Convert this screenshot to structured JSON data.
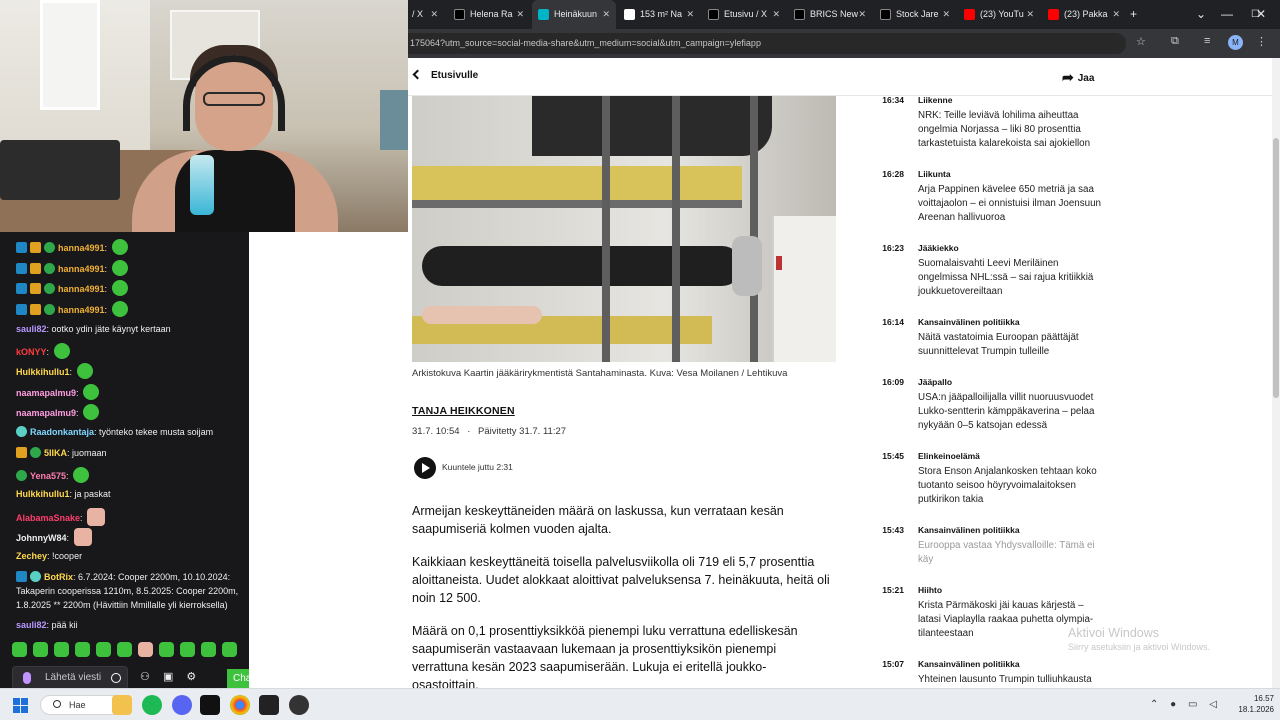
{
  "chat": {
    "messages": [
      {
        "user": "hanna4991",
        "color": "#f0b033",
        "text": ""
      },
      {
        "user": "hanna4991",
        "color": "#f0b033",
        "text": ""
      },
      {
        "user": "hanna4991",
        "color": "#f0b033",
        "text": ""
      },
      {
        "user": "hanna4991",
        "color": "#f0b033",
        "text": ""
      },
      {
        "user": "sauli82",
        "color": "#b897ff",
        "text": "ootko ydin jäte käynyt kertaan"
      },
      {
        "user": "kONYY",
        "color": "#ff3d3d",
        "text": ""
      },
      {
        "user": "Hulkkihullu1",
        "color": "#ffd84d",
        "text": ""
      },
      {
        "user": "naamapalmu9",
        "color": "#ff9de0",
        "text": ""
      },
      {
        "user": "naamapalmu9",
        "color": "#ff9de0",
        "text": ""
      },
      {
        "user": "Raadonkantaja",
        "color": "#7fd7ff",
        "text": "työnteko tekee musta soijam"
      },
      {
        "user": "5IIKA",
        "color": "#ffd84d",
        "text": "juomaan"
      },
      {
        "user": "Yena575",
        "color": "#ff7eb0",
        "text": ""
      },
      {
        "user": "Hulkkihullu1",
        "color": "#ffd84d",
        "text": "ja paskat"
      },
      {
        "user": "AlabamaSnake",
        "color": "#ff3d6a",
        "text": ""
      },
      {
        "user": "JohnnyW84",
        "color": "#efeff1",
        "text": ""
      },
      {
        "user": "Zechey",
        "color": "#ffd84d",
        "text": "!cooper"
      },
      {
        "user": "BotRix",
        "color": "#ffd84d",
        "text": "6.7.2024: Cooper 2200m, 10.10.2024: Takaperin cooperissa 1210m, 8.5.2025: Cooper 2200m, 1.8.2025 ** 2200m (Hävittiin Mmillalle yli kierroksella)"
      },
      {
        "user": "sauli82",
        "color": "#b897ff",
        "text": "pää kii"
      }
    ],
    "input_placeholder": "Lähetä viesti",
    "send_label": "Chat"
  },
  "browser": {
    "tabs": [
      {
        "label": "/ X",
        "fav": "#000000",
        "active": false
      },
      {
        "label": "Helena Ra",
        "fav": "#000000",
        "active": false
      },
      {
        "label": "Heinäkuun",
        "fav": "#00b4c8",
        "active": true
      },
      {
        "label": "153 m² Na",
        "fav": "#ffffff",
        "active": false
      },
      {
        "label": "Etusivu / X",
        "fav": "#000000",
        "active": false
      },
      {
        "label": "BRICS New",
        "fav": "#000000",
        "active": false
      },
      {
        "label": "Stock Jare",
        "fav": "#000000",
        "active": false
      },
      {
        "label": "(23) YouTu",
        "fav": "#ff0000",
        "active": false
      },
      {
        "label": "(23) Pakka",
        "fav": "#ff0000",
        "active": false
      }
    ],
    "url": "175064?utm_source=social-media-share&utm_medium=social&utm_campaign=ylefiapp",
    "avatar_letter": "M"
  },
  "article": {
    "back_label": "Etusivulle",
    "share_label": "Jaa",
    "caption": "Arkistokuva Kaartin jääkärirykmentistä Santahaminasta. Kuva: Vesa Moilanen / Lehtikuva",
    "author": "TANJA HEIKKONEN",
    "published": "31.7. 10:54",
    "updated": "Päivitetty 31.7. 11:27",
    "listen_label": "Kuuntele juttu 2:31",
    "paragraphs": [
      "Armeijan keskeyttäneiden määrä on laskussa, kun verrataan kesän saapumiseriä kolmen vuoden ajalta.",
      "Kaikkiaan keskeyttäneitä toisella palvelusviikolla oli 719 eli 5,7 prosenttia aloittaneista. Uudet alokkaat aloittivat palveluksensa 7. heinäkuuta, heitä oli noin 12 500.",
      "Määrä on 0,1 prosenttiyksikköä pienempi luku verrattuna edelliskesän saapumiserän vastaavaan lukemaan ja prosenttiyksikön pienempi verrattuna kesän 2023 saapumiserään. Lukuja ei eritellä joukko-osastoittain."
    ]
  },
  "feed": [
    {
      "time": "16:34",
      "category": "Liikenne",
      "title": "NRK: Teille leviävä lohilima aiheuttaa ongelmia Norjassa – liki 80 prosenttia tarkastetuista kalarekoista sai ajokiellon",
      "faded": false
    },
    {
      "time": "16:28",
      "category": "Liikunta",
      "title": "Arja Pappinen kävelee 650 metriä ja saa voittajaolon – ei onnistuisi ilman Joensuun Areenan hallivuoroa",
      "faded": false
    },
    {
      "time": "16:23",
      "category": "Jääkiekko",
      "title": "Suomalaisvahti Leevi Meriläinen ongelmissa NHL:ssä – sai rajua kritiikkiä joukkuetovereiltaan",
      "faded": false
    },
    {
      "time": "16:14",
      "category": "Kansainvälinen politiikka",
      "title": "Näitä vastatoimia Euroopan päättäjät suunnittelevat Trumpin tulleille",
      "faded": false
    },
    {
      "time": "16:09",
      "category": "Jääpallo",
      "title": "USA:n jääpalloilijalla villit nuoruusvuodet Lukko-sentterin kämppäkaverina – pelaa nykyään 0–5 katsojan edessä",
      "faded": false
    },
    {
      "time": "15:45",
      "category": "Elinkeinoelämä",
      "title": "Stora Enson Anjalankosken tehtaan koko tuotanto seisoo höyryvoimalaitoksen putkirikon takia",
      "faded": false
    },
    {
      "time": "15:43",
      "category": "Kansainvälinen politiikka",
      "title": "Eurooppa vastaa Yhdysvalloille: Tämä ei käy",
      "faded": true
    },
    {
      "time": "15:21",
      "category": "Hiihto",
      "title": "Krista Pärmäkoski jäi kauas kärjestä – latasi Viaplaylla raakaa puhetta olympia-tilanteestaan",
      "faded": false
    },
    {
      "time": "15:07",
      "category": "Kansainvälinen politiikka",
      "title": "Yhteinen lausunto Trumpin tulliuhkausta",
      "faded": false
    }
  ],
  "watermark": {
    "title": "Aktivoi Windows",
    "subtitle": "Siirry asetuksiin ja aktivoi Windows."
  },
  "taskbar": {
    "search_label": "Hae",
    "time": "16.57",
    "date": "18.1.2026"
  }
}
